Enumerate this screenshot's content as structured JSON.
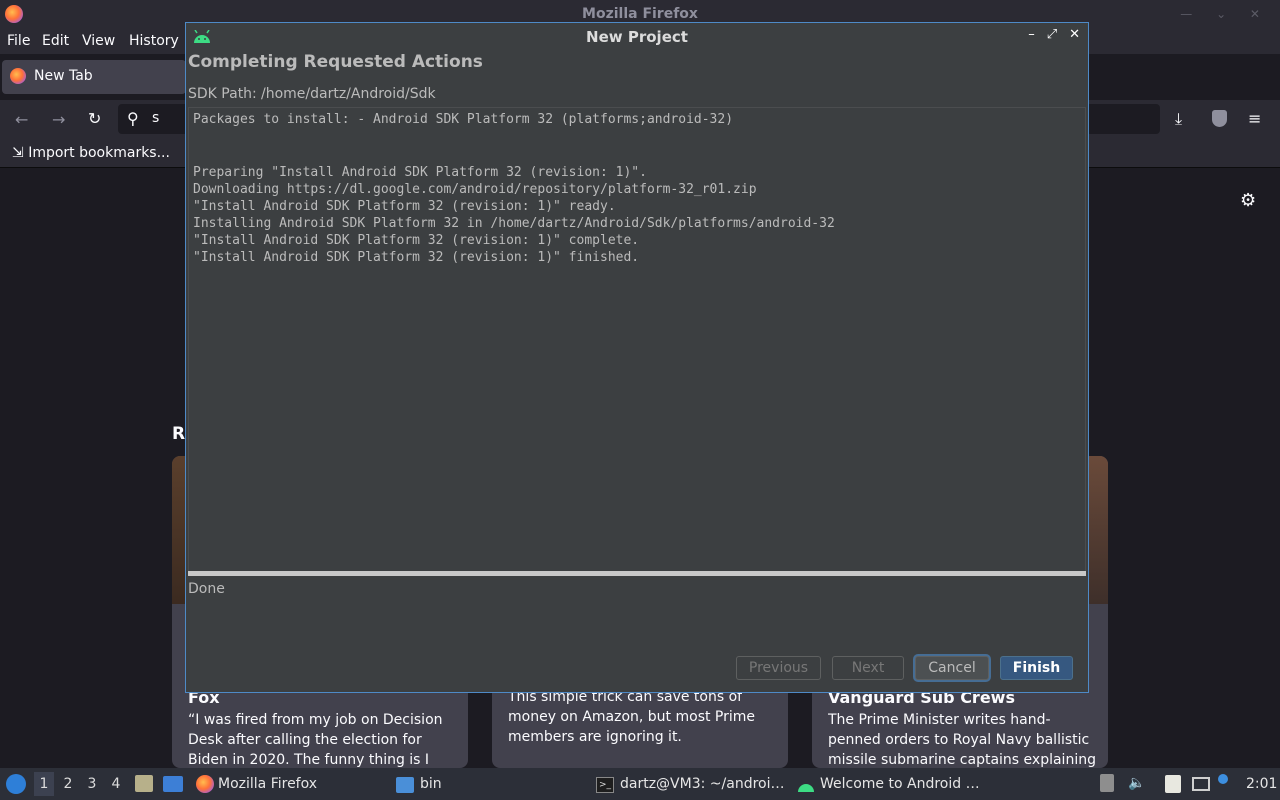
{
  "firefox": {
    "window_title": "Mozilla Firefox",
    "menu": [
      "File",
      "Edit",
      "View",
      "History"
    ],
    "tab_label": "New Tab",
    "url_text": "s",
    "bookmark_import": "Import bookmarks...",
    "section_heading_fragment": "Re",
    "stories": [
      {
        "title": "Fox",
        "text": "“I was fired from my job on Decision Desk after calling the election for Biden in 2020. The funny thing is I should have…"
      },
      {
        "title": "",
        "text": "This simple trick can save tons of money on Amazon, but most Prime members are ignoring it."
      },
      {
        "title": "Vanguard Sub Crews",
        "text": "The Prime Minister writes hand-penned orders to Royal Navy ballistic missile submarine captains explaining what to …"
      }
    ]
  },
  "dialog": {
    "title": "New Project",
    "header": "Completing Requested Actions",
    "sdk_path_label": "SDK Path:",
    "sdk_path_value": "/home/dartz/Android/Sdk",
    "packages_line": "Packages to install: - Android SDK Platform 32 (platforms;android-32)",
    "log_lines": [
      "Preparing \"Install Android SDK Platform 32 (revision: 1)\".",
      "Downloading https://dl.google.com/android/repository/platform-32_r01.zip",
      "\"Install Android SDK Platform 32 (revision: 1)\" ready.",
      "Installing Android SDK Platform 32 in /home/dartz/Android/Sdk/platforms/android-32",
      "\"Install Android SDK Platform 32 (revision: 1)\" complete.",
      "\"Install Android SDK Platform 32 (revision: 1)\" finished."
    ],
    "progress_fraction": 1.0,
    "status": "Done",
    "buttons": {
      "previous": "Previous",
      "next": "Next",
      "cancel": "Cancel",
      "finish": "Finish"
    }
  },
  "taskbar": {
    "workspaces": [
      "1",
      "2",
      "3",
      "4"
    ],
    "apps": [
      "Mozilla Firefox",
      "bin",
      "dartz@VM3: ~/androi…",
      "Welcome to Android …"
    ],
    "clock": "2:01"
  },
  "colors": {
    "accent": "#365880",
    "android_green": "#3ddc84"
  }
}
